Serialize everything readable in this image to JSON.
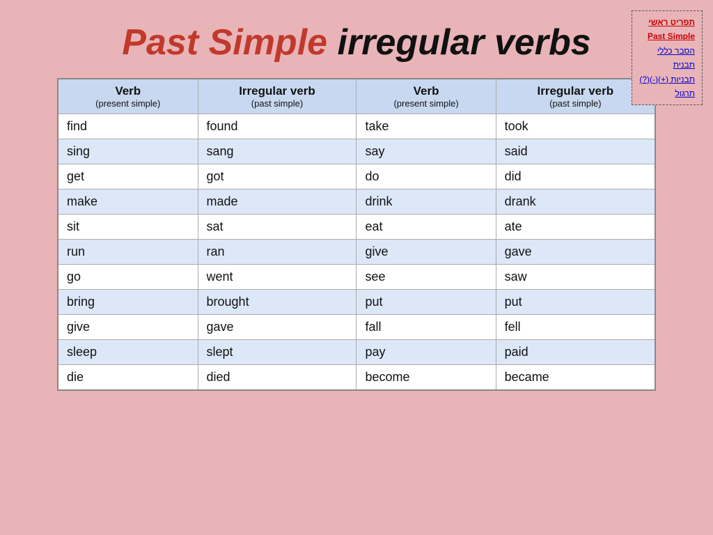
{
  "background_color": "#e8b4b8",
  "nav": {
    "items": [
      {
        "label": "תפריט ראשי",
        "style": "red-underline"
      },
      {
        "label": "Past Simple",
        "style": "red-underline"
      },
      {
        "label": "הסבר כללי",
        "style": "blue-underline"
      },
      {
        "label": "תבנית",
        "style": "blue-underline"
      },
      {
        "label": "תבניות (+)(-)(?)",
        "style": "blue-underline"
      },
      {
        "label": "תרגול",
        "style": "blue-underline"
      }
    ]
  },
  "title": {
    "part1": "Past Simple",
    "part2": " irregular verbs"
  },
  "table": {
    "headers": [
      {
        "main": "Verb",
        "sub": "(present simple)"
      },
      {
        "main": "Irregular verb",
        "sub": "(past simple)"
      },
      {
        "main": "Verb",
        "sub": "(present simple)"
      },
      {
        "main": "Irregular verb",
        "sub": "(past simple)"
      }
    ],
    "rows": [
      [
        "find",
        "found",
        "take",
        "took"
      ],
      [
        "sing",
        "sang",
        "say",
        "said"
      ],
      [
        "get",
        "got",
        "do",
        "did"
      ],
      [
        "make",
        "made",
        "drink",
        "drank"
      ],
      [
        "sit",
        "sat",
        "eat",
        "ate"
      ],
      [
        "run",
        "ran",
        "give",
        "gave"
      ],
      [
        "go",
        "went",
        "see",
        "saw"
      ],
      [
        "bring",
        "brought",
        "put",
        "put"
      ],
      [
        "give",
        "gave",
        "fall",
        "fell"
      ],
      [
        "sleep",
        "slept",
        "pay",
        "paid"
      ],
      [
        "die",
        "died",
        "become",
        "became"
      ]
    ]
  }
}
